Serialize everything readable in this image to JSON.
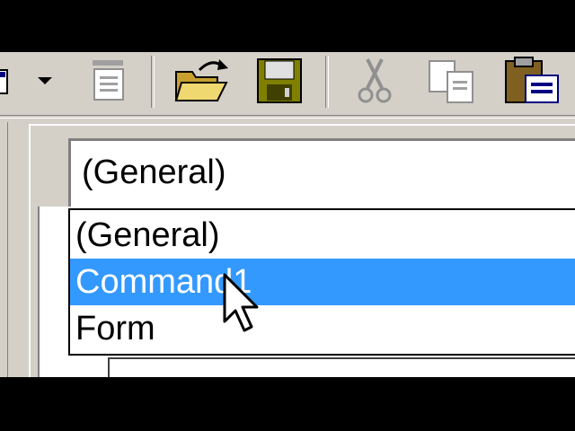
{
  "toolbar": {
    "items": [
      {
        "name": "dropdown-arrow-icon"
      },
      {
        "name": "menu-editor-icon"
      },
      {
        "name": "open-project-icon"
      },
      {
        "name": "save-project-icon"
      },
      {
        "name": "cut-icon"
      },
      {
        "name": "copy-icon"
      },
      {
        "name": "paste-icon"
      }
    ]
  },
  "object_combo": {
    "value": "(General)",
    "options": [
      "(General)",
      "Command1",
      "Form"
    ],
    "selected_index": 1
  },
  "colors": {
    "face": "#d4d0c8",
    "highlight": "#3399ff",
    "folder": "#e8c860",
    "disk": "#808000"
  }
}
